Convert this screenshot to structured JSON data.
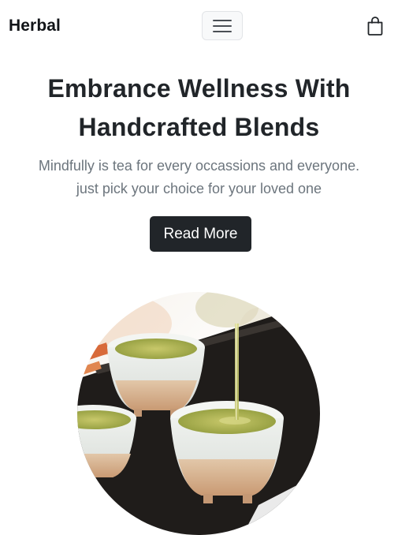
{
  "navbar": {
    "brand": "Herbal",
    "menu_icon": "hamburger-menu-icon",
    "cart_icon": "shopping-bag-icon"
  },
  "hero": {
    "title_line1": "Embrance Wellness With",
    "title_line2": "Handcrafted Blends",
    "subtitle_line1": "Mindfully is tea for every occassions and everyone.",
    "subtitle_line2": "just pick your choice for your loved one",
    "cta_label": "Read More",
    "image_subject": "green tea cups"
  },
  "colors": {
    "text_dark": "#212529",
    "text_muted": "#6c757d",
    "button_bg": "#212529",
    "button_text": "#ffffff",
    "toggler_border": "#e2e4e7"
  }
}
